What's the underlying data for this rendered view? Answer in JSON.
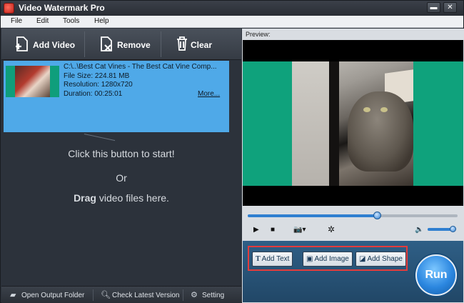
{
  "window": {
    "title": "Video Watermark Pro",
    "minimize_glyph": "▬",
    "close_glyph": "✕"
  },
  "menu": [
    "File",
    "Edit",
    "Tools",
    "Help"
  ],
  "toolbar": {
    "add_video": "Add Video",
    "remove": "Remove",
    "clear": "Clear"
  },
  "file": {
    "path": "C:\\..\\Best Cat Vines - The Best Cat Vine Comp...",
    "size": "File Size: 224.81 MB",
    "resolution": "Resolution: 1280x720",
    "duration": "Duration: 00:25:01",
    "more": "More..."
  },
  "hints": {
    "start": "Click this button to start!",
    "or": "Or",
    "drag_bold": "Drag",
    "drag_rest": " video files here."
  },
  "bottom_bar": {
    "open_output": "Open Output Folder",
    "check_version": "Check Latest Version",
    "setting": "Setting"
  },
  "preview": {
    "label": "Preview:",
    "seek_fraction": 0.62,
    "volume_fraction": 0.9
  },
  "controls": {
    "play_glyph": "▶",
    "stop_glyph": "■",
    "snapshot_glyph": "📷▾",
    "effects_glyph": "✲",
    "volume_glyph": "🔈"
  },
  "actions": {
    "add_text": "Add Text",
    "add_image": "Add Image",
    "add_shape": "Add Shape",
    "run": "Run"
  },
  "colors": {
    "accent": "#2f7fd0",
    "highlight_border": "#e43c3c",
    "selected_item": "#4fa9e8",
    "video_background": "#0fa27c"
  }
}
